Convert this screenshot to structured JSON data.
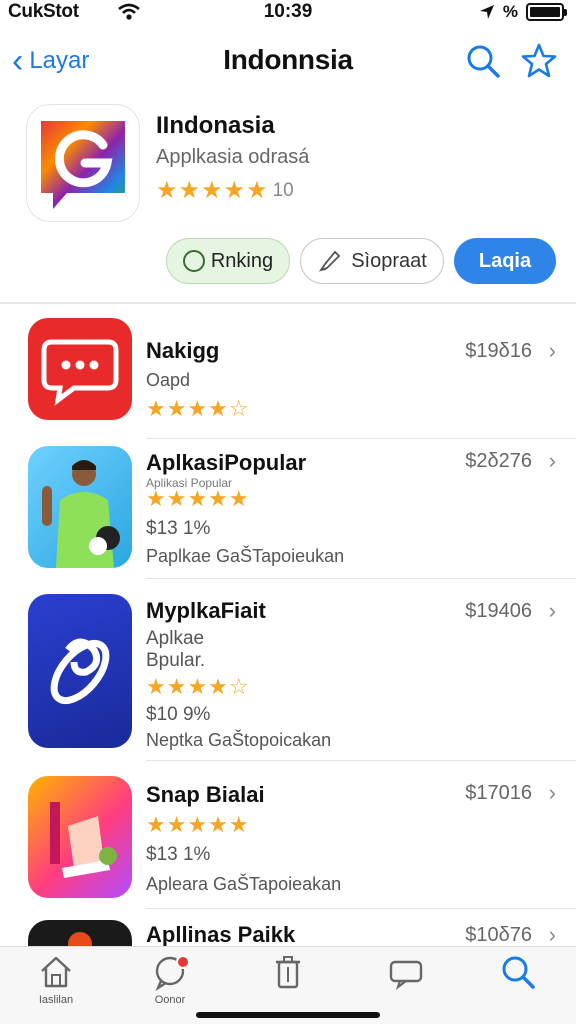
{
  "status": {
    "carrier": "CukStot",
    "time": "10:39",
    "indicator": "%"
  },
  "nav": {
    "back_label": "Layar",
    "title": "Indonnsia"
  },
  "hero": {
    "name": "IIndonasia",
    "subtitle": "Applkasia odrasá",
    "stars": "★★★★★",
    "rating_count": "10",
    "rank_label": "Rnking",
    "share_label": "Sìopraat",
    "get_label": "Laqia"
  },
  "apps": [
    {
      "name": "Nakigg",
      "line1": "Oapd",
      "line2": "",
      "line3": "",
      "stars": "★★★★☆",
      "price": "$19δ16"
    },
    {
      "name": "AplkasiPopular",
      "line1": "Aplikasi Popular",
      "line2": "$13 1%",
      "line3": "Paplkae GaŠTapoieukan",
      "stars": "★★★★★",
      "price": "$2δ276"
    },
    {
      "name": "MyplkaFiait",
      "line1": "Aplkae",
      "line2": "Bpular.",
      "line3": "$10 9%",
      "line4": "Neptka GaŠtopoicakan",
      "stars": "★★★★☆",
      "price": "$19406"
    },
    {
      "name": "Snap Bialai",
      "line1": "$13 1%",
      "line2": "Apleara GaŠTapoieakan",
      "stars": "★★★★★",
      "price": "$17016"
    },
    {
      "name": "Apllinas Paikk",
      "price": "$10δ76"
    }
  ],
  "tabs": [
    {
      "label": "Iaslilan",
      "icon": "home-icon"
    },
    {
      "label": "Oonor",
      "icon": "chat-icon"
    },
    {
      "label": "",
      "icon": "trash-icon"
    },
    {
      "label": "",
      "icon": "message-icon"
    },
    {
      "label": "",
      "icon": "search-icon"
    }
  ],
  "colors": {
    "accent": "#2f84e8",
    "star": "#f5a623",
    "rank_bg": "#e6f5e1"
  }
}
